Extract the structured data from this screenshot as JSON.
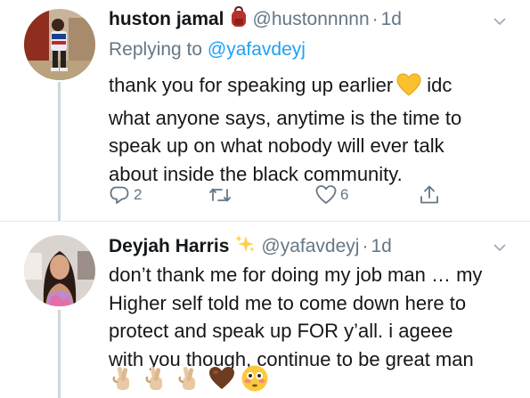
{
  "tweet1": {
    "name": "huston jamal",
    "name_icon": "backpack-icon",
    "handle": "@hustonnnnn",
    "separator": "·",
    "time": "1d",
    "reply_prefix": "Replying to",
    "reply_to": "@yafavdeyj",
    "text_lines": [
      "thank you for speaking up earlier",
      "idc",
      "what anyone says, anytime is the time to",
      "speak up on what nobody will ever talk",
      "about inside the black community."
    ],
    "inline_emoji": "yellow-heart-icon",
    "actions": {
      "reply_count": "2",
      "retweet_count": "",
      "like_count": "6"
    }
  },
  "tweet2": {
    "name": "Deyjah Harris",
    "name_icon": "sparkles-icon",
    "handle": "@yafavdeyj",
    "separator": "·",
    "time": "1d",
    "text_lines": [
      "don’t thank me for doing my job man … my",
      "Higher self told me to come down here to",
      "protect and speak up FOR y’all. i ageee",
      "with you though, continue to be great man"
    ],
    "emojis": [
      "crossed-fingers-icon",
      "crossed-fingers-icon",
      "crossed-fingers-icon",
      "brown-heart-icon",
      "flushed-face-icon"
    ]
  },
  "colors": {
    "text": "#14171a",
    "secondary": "#657786",
    "link": "#1da1f2",
    "divider": "#e6ecf0",
    "thread_line": "#ccd6dd"
  }
}
